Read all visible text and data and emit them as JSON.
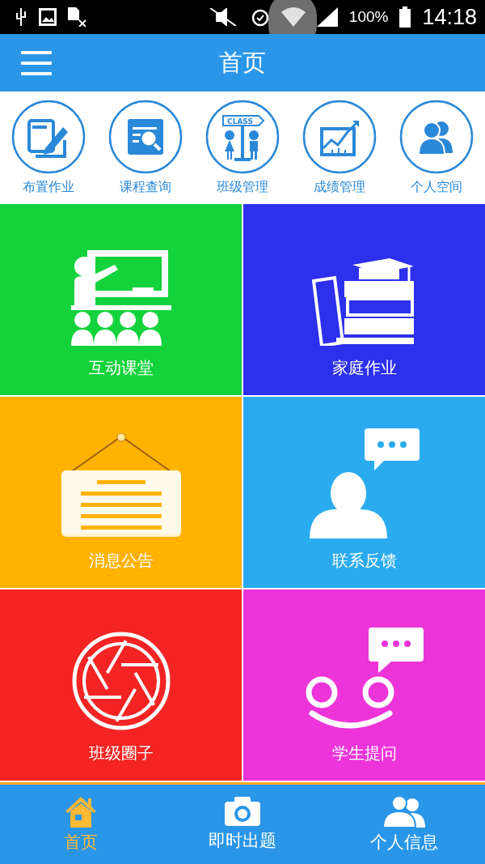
{
  "status_bar": {
    "battery": "100%",
    "time": "14:18"
  },
  "app_bar": {
    "title": "首页"
  },
  "shortcuts": [
    {
      "kind": "assign",
      "label": "布置作业"
    },
    {
      "kind": "course",
      "label": "课程查询"
    },
    {
      "kind": "class",
      "label": "班级管理",
      "sign": "CLASS"
    },
    {
      "kind": "grades",
      "label": "成绩管理"
    },
    {
      "kind": "space",
      "label": "个人空间"
    }
  ],
  "tiles": [
    {
      "kind": "classroom",
      "label": "互动课堂",
      "color": "#14d23c"
    },
    {
      "kind": "books",
      "label": "家庭作业",
      "color": "#2d30ec"
    },
    {
      "kind": "notice",
      "label": "消息公告",
      "color": "#ffb300"
    },
    {
      "kind": "feedback",
      "label": "联系反馈",
      "color": "#2aabef"
    },
    {
      "kind": "shutter",
      "label": "班级圈子",
      "color": "#f42424"
    },
    {
      "kind": "question",
      "label": "学生提问",
      "color": "#ec34d9"
    }
  ],
  "bottom_nav": [
    {
      "kind": "home",
      "label": "首页",
      "selected": true
    },
    {
      "kind": "camera",
      "label": "即时出题",
      "selected": false
    },
    {
      "kind": "people",
      "label": "个人信息",
      "selected": false
    }
  ]
}
